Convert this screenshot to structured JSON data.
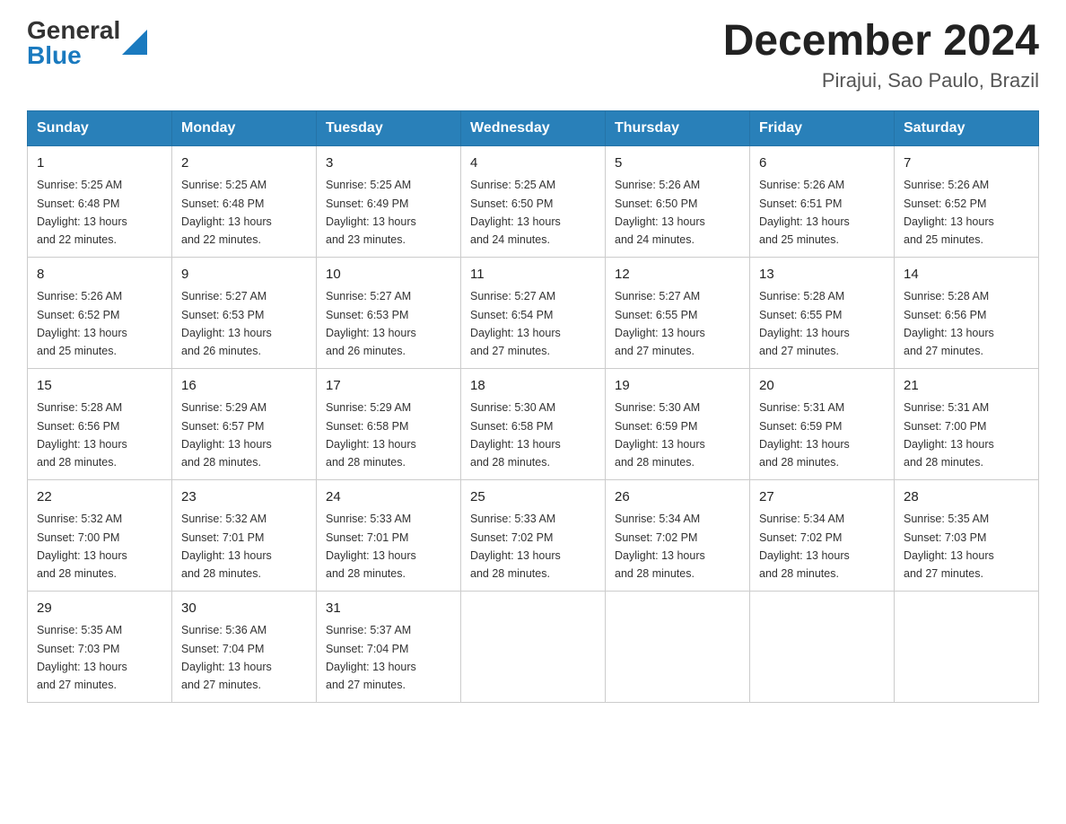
{
  "header": {
    "logo_general": "General",
    "logo_blue": "Blue",
    "calendar_title": "December 2024",
    "calendar_subtitle": "Pirajui, Sao Paulo, Brazil"
  },
  "weekdays": [
    "Sunday",
    "Monday",
    "Tuesday",
    "Wednesday",
    "Thursday",
    "Friday",
    "Saturday"
  ],
  "weeks": [
    [
      {
        "day": "1",
        "sunrise": "5:25 AM",
        "sunset": "6:48 PM",
        "daylight": "13 hours and 22 minutes."
      },
      {
        "day": "2",
        "sunrise": "5:25 AM",
        "sunset": "6:48 PM",
        "daylight": "13 hours and 22 minutes."
      },
      {
        "day": "3",
        "sunrise": "5:25 AM",
        "sunset": "6:49 PM",
        "daylight": "13 hours and 23 minutes."
      },
      {
        "day": "4",
        "sunrise": "5:25 AM",
        "sunset": "6:50 PM",
        "daylight": "13 hours and 24 minutes."
      },
      {
        "day": "5",
        "sunrise": "5:26 AM",
        "sunset": "6:50 PM",
        "daylight": "13 hours and 24 minutes."
      },
      {
        "day": "6",
        "sunrise": "5:26 AM",
        "sunset": "6:51 PM",
        "daylight": "13 hours and 25 minutes."
      },
      {
        "day": "7",
        "sunrise": "5:26 AM",
        "sunset": "6:52 PM",
        "daylight": "13 hours and 25 minutes."
      }
    ],
    [
      {
        "day": "8",
        "sunrise": "5:26 AM",
        "sunset": "6:52 PM",
        "daylight": "13 hours and 25 minutes."
      },
      {
        "day": "9",
        "sunrise": "5:27 AM",
        "sunset": "6:53 PM",
        "daylight": "13 hours and 26 minutes."
      },
      {
        "day": "10",
        "sunrise": "5:27 AM",
        "sunset": "6:53 PM",
        "daylight": "13 hours and 26 minutes."
      },
      {
        "day": "11",
        "sunrise": "5:27 AM",
        "sunset": "6:54 PM",
        "daylight": "13 hours and 27 minutes."
      },
      {
        "day": "12",
        "sunrise": "5:27 AM",
        "sunset": "6:55 PM",
        "daylight": "13 hours and 27 minutes."
      },
      {
        "day": "13",
        "sunrise": "5:28 AM",
        "sunset": "6:55 PM",
        "daylight": "13 hours and 27 minutes."
      },
      {
        "day": "14",
        "sunrise": "5:28 AM",
        "sunset": "6:56 PM",
        "daylight": "13 hours and 27 minutes."
      }
    ],
    [
      {
        "day": "15",
        "sunrise": "5:28 AM",
        "sunset": "6:56 PM",
        "daylight": "13 hours and 28 minutes."
      },
      {
        "day": "16",
        "sunrise": "5:29 AM",
        "sunset": "6:57 PM",
        "daylight": "13 hours and 28 minutes."
      },
      {
        "day": "17",
        "sunrise": "5:29 AM",
        "sunset": "6:58 PM",
        "daylight": "13 hours and 28 minutes."
      },
      {
        "day": "18",
        "sunrise": "5:30 AM",
        "sunset": "6:58 PM",
        "daylight": "13 hours and 28 minutes."
      },
      {
        "day": "19",
        "sunrise": "5:30 AM",
        "sunset": "6:59 PM",
        "daylight": "13 hours and 28 minutes."
      },
      {
        "day": "20",
        "sunrise": "5:31 AM",
        "sunset": "6:59 PM",
        "daylight": "13 hours and 28 minutes."
      },
      {
        "day": "21",
        "sunrise": "5:31 AM",
        "sunset": "7:00 PM",
        "daylight": "13 hours and 28 minutes."
      }
    ],
    [
      {
        "day": "22",
        "sunrise": "5:32 AM",
        "sunset": "7:00 PM",
        "daylight": "13 hours and 28 minutes."
      },
      {
        "day": "23",
        "sunrise": "5:32 AM",
        "sunset": "7:01 PM",
        "daylight": "13 hours and 28 minutes."
      },
      {
        "day": "24",
        "sunrise": "5:33 AM",
        "sunset": "7:01 PM",
        "daylight": "13 hours and 28 minutes."
      },
      {
        "day": "25",
        "sunrise": "5:33 AM",
        "sunset": "7:02 PM",
        "daylight": "13 hours and 28 minutes."
      },
      {
        "day": "26",
        "sunrise": "5:34 AM",
        "sunset": "7:02 PM",
        "daylight": "13 hours and 28 minutes."
      },
      {
        "day": "27",
        "sunrise": "5:34 AM",
        "sunset": "7:02 PM",
        "daylight": "13 hours and 28 minutes."
      },
      {
        "day": "28",
        "sunrise": "5:35 AM",
        "sunset": "7:03 PM",
        "daylight": "13 hours and 27 minutes."
      }
    ],
    [
      {
        "day": "29",
        "sunrise": "5:35 AM",
        "sunset": "7:03 PM",
        "daylight": "13 hours and 27 minutes."
      },
      {
        "day": "30",
        "sunrise": "5:36 AM",
        "sunset": "7:04 PM",
        "daylight": "13 hours and 27 minutes."
      },
      {
        "day": "31",
        "sunrise": "5:37 AM",
        "sunset": "7:04 PM",
        "daylight": "13 hours and 27 minutes."
      },
      null,
      null,
      null,
      null
    ]
  ],
  "labels": {
    "sunrise": "Sunrise:",
    "sunset": "Sunset:",
    "daylight": "Daylight:"
  }
}
